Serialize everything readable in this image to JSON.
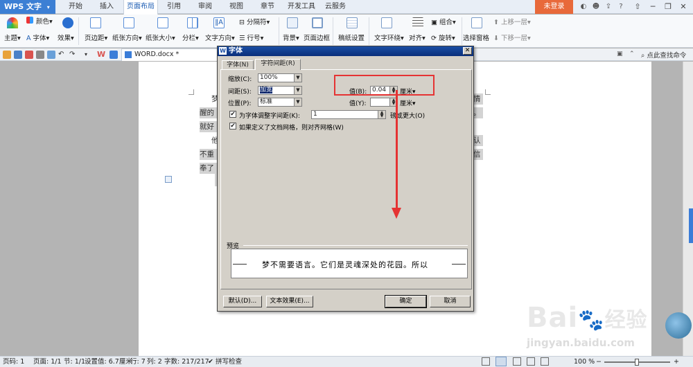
{
  "app": {
    "title": "WPS 文字",
    "login_label": "未登录"
  },
  "ribbon_tabs": [
    "开始",
    "插入",
    "页面布局",
    "引用",
    "审阅",
    "视图",
    "章节",
    "开发工具",
    "云服务"
  ],
  "ribbon": {
    "theme": "主题",
    "color": "颜色",
    "font": "字体",
    "effect": "效果",
    "margin": "页边距",
    "orientation": "纸张方向",
    "size": "纸张大小",
    "columns": "分栏",
    "text_direction": "文字方向",
    "separator": "分隔符",
    "line_number": "行号",
    "background": "背景",
    "page_border": "页面边框",
    "manuscript": "稿纸设置",
    "text_wrap": "文字环绕",
    "align": "对齐",
    "group": "组合",
    "rotate": "旋转",
    "selection_pane": "选择窗格",
    "bring_forward": "上移一层",
    "send_backward": "下移一层"
  },
  "quickbar": {
    "doc_name": "WORD.docx *",
    "search_command": "点此查找命令"
  },
  "document": {
    "lines": [
      "梦",
      "醒的",
      "就好",
      "他",
      "不重",
      "奉了"
    ],
    "right_chars": [
      "情",
      "。",
      "认",
      "信"
    ]
  },
  "dialog": {
    "title": "字体",
    "tabs": [
      "字体(N)",
      "字符间距(R)"
    ],
    "scale_label": "缩放(C):",
    "scale_value": "100%",
    "spacing_label": "间距(S):",
    "spacing_value": "加宽",
    "position_label": "位置(P):",
    "position_value": "标准",
    "value_b_label": "值(B):",
    "value_b": "0.04",
    "value_b_unit": "厘米",
    "value_y_label": "值(Y):",
    "value_y": "",
    "value_y_unit": "厘米",
    "kerning_label": "为字体调整字间距(K):",
    "kerning_value": "1",
    "kerning_suffix": "磅或更大(O)",
    "kerning_checked": true,
    "grid_label": "如果定义了文档网格，则对齐网格(W)",
    "grid_checked": true,
    "preview_label": "预览",
    "preview_text": "梦不需要语言。它们是灵魂深处的花园。所以",
    "default_btn": "默认(D)...",
    "text_effect_btn": "文本效果(E)...",
    "ok_btn": "确定",
    "cancel_btn": "取消"
  },
  "status": {
    "page_code": "页码: 1",
    "page": "页面: 1/1",
    "section": "节: 1/1",
    "setting": "设置值: 6.7厘米",
    "row": "行: 7",
    "col": "列: 2",
    "words": "字数: 217/217",
    "spell": "拼写检查",
    "zoom": "100 %"
  },
  "watermark": {
    "brand": "Bai",
    "brand2": "经验",
    "url": "jingyan.baidu.com"
  },
  "colors": {
    "accent": "#3c7fd4",
    "login": "#e8693a",
    "highlight": "#e53333"
  }
}
